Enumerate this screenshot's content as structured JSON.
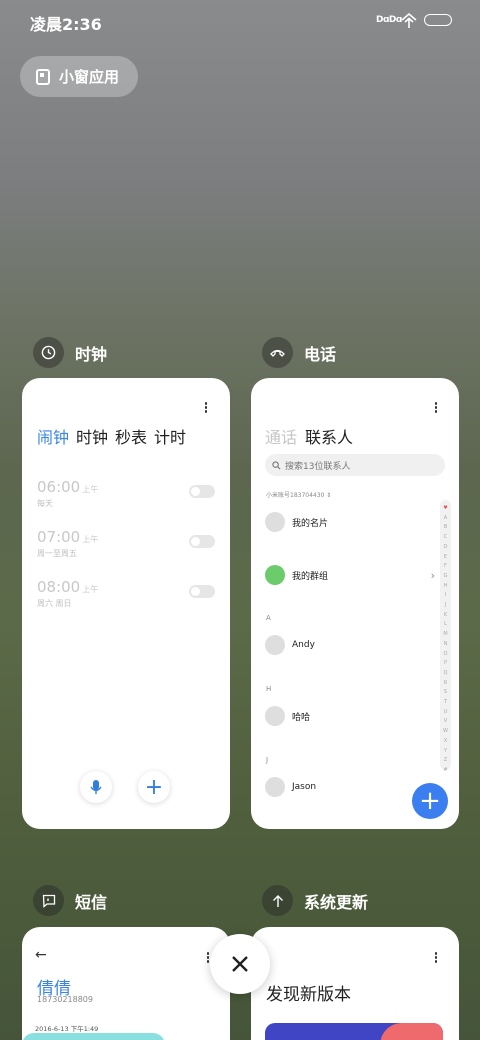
{
  "status": {
    "time": "凌晨2:36",
    "signal": "DɑDɑ"
  },
  "small_window": {
    "label": "小窗应用"
  },
  "clock": {
    "app_name": "时钟",
    "tabs": [
      "闹钟",
      "时钟",
      "秒表",
      "计时"
    ],
    "alarms": [
      {
        "time": "06:00",
        "ampm": "上午",
        "repeat": "每天"
      },
      {
        "time": "07:00",
        "ampm": "上午",
        "repeat": "周一至周五"
      },
      {
        "time": "08:00",
        "ampm": "上午",
        "repeat": "周六 周日"
      }
    ]
  },
  "phone": {
    "app_name": "电话",
    "tabs": [
      "通话",
      "联系人"
    ],
    "search_placeholder": "搜索13位联系人",
    "account": "小米账号183704430",
    "contacts": [
      {
        "name": "我的名片"
      },
      {
        "name": "我的群组"
      }
    ],
    "sections": [
      {
        "letter": "A",
        "name": "Andy"
      },
      {
        "letter": "H",
        "name": "哈哈"
      },
      {
        "letter": "J",
        "name": "Jason"
      }
    ],
    "alphabet": [
      "♥",
      "A",
      "B",
      "C",
      "D",
      "E",
      "F",
      "G",
      "H",
      "I",
      "J",
      "K",
      "L",
      "M",
      "N",
      "O",
      "P",
      "Q",
      "R",
      "S",
      "T",
      "U",
      "V",
      "W",
      "X",
      "Y",
      "Z",
      "#"
    ]
  },
  "sms": {
    "app_name": "短信",
    "contact": "倩倩",
    "number": "18730218809",
    "date": "2016-6-13 下午1:49"
  },
  "update": {
    "app_name": "系统更新",
    "headline": "发现新版本"
  }
}
